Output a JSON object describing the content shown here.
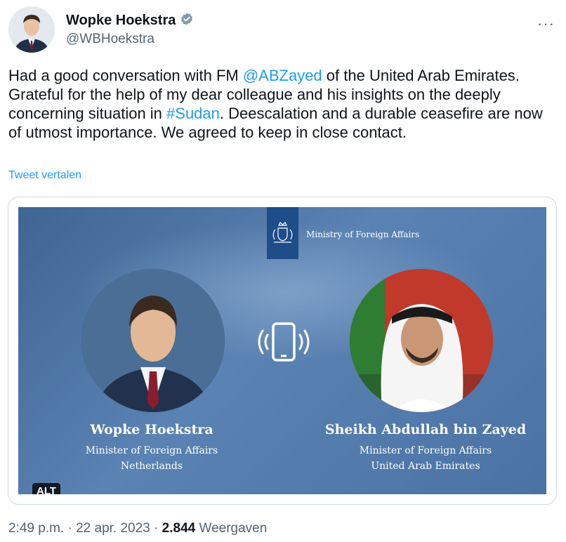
{
  "author": {
    "name": "Wopke Hoekstra",
    "handle": "@WBHoekstra",
    "verified_color": "#829aab"
  },
  "more_menu": {
    "label": "···"
  },
  "tweet": {
    "part1": "Had a good conversation with FM ",
    "mention": "@ABZayed",
    "part2": " of the United Arab Emirates. Grateful for the help of my dear colleague and his insights on the deeply concerning situation in ",
    "hashtag": "#Sudan",
    "part3": ". Deescalation and a durable ceasefire are now of utmost importance. We agreed to keep in close contact."
  },
  "translate_label": "Tweet vertalen",
  "media": {
    "ministry_label": "Ministry of Foreign Affairs",
    "left_person": {
      "name": "Wopke Hoekstra",
      "role": "Minister of Foreign Affairs",
      "country": "Netherlands"
    },
    "right_person": {
      "name": "Sheikh Abdullah bin Zayed",
      "role": "Minister of Foreign Affairs",
      "country": "United Arab Emirates"
    },
    "alt_label": "ALT",
    "icons": [
      "royal-crest-icon",
      "phone-call-icon"
    ]
  },
  "meta": {
    "time": "2:49 p.m.",
    "sep1": " · ",
    "date": "22 apr. 2023",
    "sep2": " · ",
    "views": "2.844",
    "views_label": " Weergaven"
  },
  "colors": {
    "link": "#1d9bf0",
    "secondary_text": "#536471",
    "card_background": "#4a72a4"
  }
}
